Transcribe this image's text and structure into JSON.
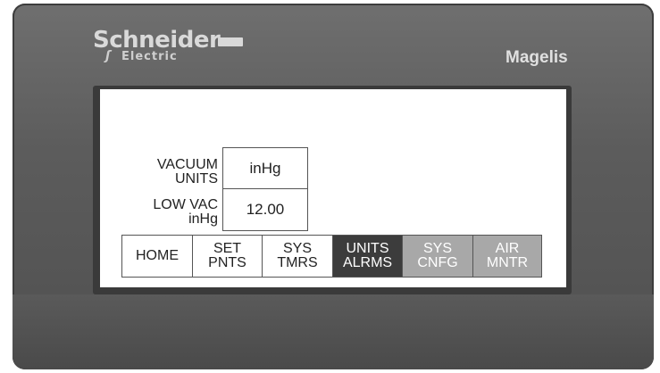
{
  "device": {
    "brand": "Schneider",
    "brand_sub": "Electric",
    "model": "Magelis"
  },
  "fields": [
    {
      "label_line1": "VACUUM",
      "label_line2": "UNITS",
      "value": "inHg"
    },
    {
      "label_line1": "LOW VAC",
      "label_line2": "inHg",
      "value": "12.00"
    }
  ],
  "nav": [
    {
      "line1": "HOME",
      "line2": ""
    },
    {
      "line1": "SET",
      "line2": "PNTS"
    },
    {
      "line1": "SYS",
      "line2": "TMRS"
    },
    {
      "line1": "UNITS",
      "line2": "ALRMS"
    },
    {
      "line1": "SYS",
      "line2": "CNFG"
    },
    {
      "line1": "AIR",
      "line2": "MNTR"
    }
  ],
  "colors": {
    "active_tab": "#3c3c3c",
    "disabled_tab": "#a8a8a8",
    "bezel": "#5e5e5e"
  }
}
